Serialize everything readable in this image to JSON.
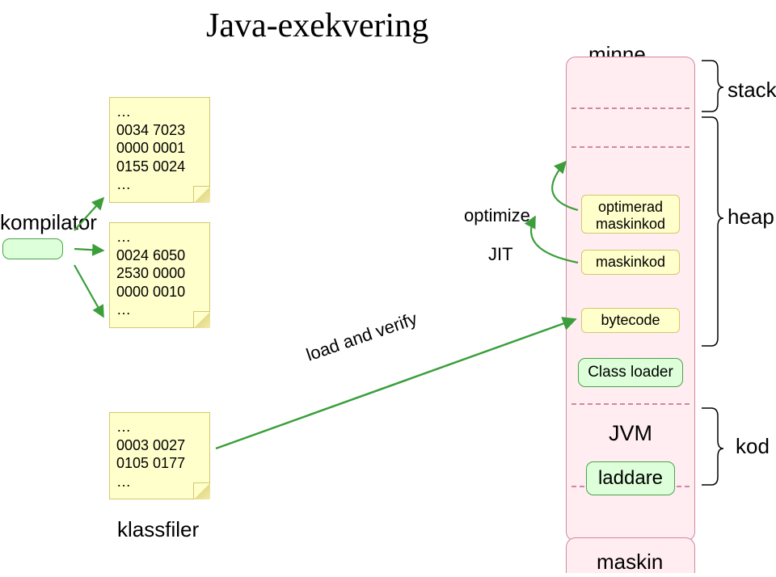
{
  "title": "Java-exekvering",
  "labels": {
    "minne": "minne",
    "stack": "stack",
    "heap": "heap",
    "kod": "kod",
    "kompilator": "kompilator",
    "klassfiler": "klassfiler",
    "maskin": "maskin"
  },
  "notes": {
    "n1": {
      "l1": "…",
      "l2": "0034 7023",
      "l3": "0000 0001",
      "l4": "0155 0024",
      "l5": "…"
    },
    "n2": {
      "l1": "…",
      "l2": "0024 6050",
      "l3": "2530 0000",
      "l4": "0000 0010",
      "l5": "…"
    },
    "n3": {
      "l1": "…",
      "l2": "0003 0027",
      "l3": "0105 0177",
      "l4": "…"
    }
  },
  "mem": {
    "optimerad": "optimerad maskinkod",
    "maskinkod": "maskinkod",
    "bytecode": "bytecode",
    "classloader": "Class loader",
    "jvm": "JVM",
    "laddare": "laddare"
  },
  "arrows": {
    "optimize": "optimize",
    "jit": "JIT",
    "loadverify": "load and verify"
  },
  "chart_data": {
    "type": "diagram",
    "title": "Java-exekvering",
    "nodes": [
      {
        "id": "source",
        "label": "",
        "kind": "source"
      },
      {
        "id": "kompilator",
        "label": "kompilator"
      },
      {
        "id": "klass1",
        "label": "0034 7023 / 0000 0001 / 0155 0024",
        "kind": "klassfil"
      },
      {
        "id": "klass2",
        "label": "0024 6050 / 2530 0000 / 0000 0010",
        "kind": "klassfil"
      },
      {
        "id": "klass3",
        "label": "0003 0027 / 0105 0177",
        "kind": "klassfil"
      },
      {
        "id": "classloader",
        "label": "Class loader"
      },
      {
        "id": "bytecode",
        "label": "bytecode"
      },
      {
        "id": "maskinkod",
        "label": "maskinkod"
      },
      {
        "id": "optimerad",
        "label": "optimerad maskinkod"
      },
      {
        "id": "jvm",
        "label": "JVM"
      },
      {
        "id": "laddare",
        "label": "laddare"
      },
      {
        "id": "maskin",
        "label": "maskin"
      }
    ],
    "edges": [
      {
        "from": "source",
        "to": "klass1",
        "via": "kompilator"
      },
      {
        "from": "source",
        "to": "klass2",
        "via": "kompilator"
      },
      {
        "from": "source",
        "to": "klass3",
        "via": "kompilator"
      },
      {
        "from": "klass3",
        "to": "classloader",
        "label": "load and verify"
      },
      {
        "from": "bytecode",
        "to": "maskinkod",
        "label": "JIT"
      },
      {
        "from": "maskinkod",
        "to": "optimerad",
        "label": "optimize"
      }
    ],
    "memory_regions": [
      {
        "name": "stack",
        "contains": []
      },
      {
        "name": "heap",
        "contains": [
          "optimerad maskinkod",
          "maskinkod",
          "bytecode",
          "Class loader"
        ]
      },
      {
        "name": "kod",
        "contains": [
          "JVM",
          "laddare"
        ]
      }
    ]
  }
}
